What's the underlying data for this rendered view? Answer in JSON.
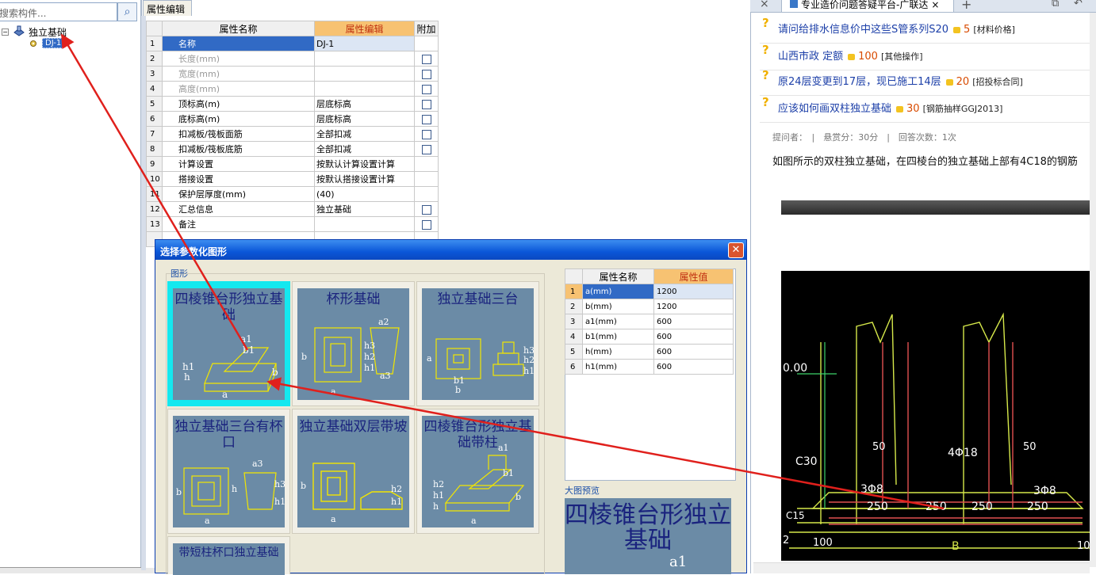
{
  "left_panel": {
    "search_placeholder": "搜索构件...",
    "tree_root": "独立基础",
    "tree_child": "DJ-1"
  },
  "mid_panel": {
    "tab_label": "属性编辑",
    "headers": [
      "属性名称",
      "属性编辑",
      "附加"
    ],
    "rows": [
      {
        "n": "1",
        "name": "名称",
        "value": "DJ-1",
        "check": false
      },
      {
        "n": "2",
        "name": "长度(mm)",
        "value": "",
        "check": true
      },
      {
        "n": "3",
        "name": "宽度(mm)",
        "value": "",
        "check": true
      },
      {
        "n": "4",
        "name": "高度(mm)",
        "value": "",
        "check": true
      },
      {
        "n": "5",
        "name": "顶标高(m)",
        "value": "层底标高",
        "check": true
      },
      {
        "n": "6",
        "name": "底标高(m)",
        "value": "层底标高",
        "check": true
      },
      {
        "n": "7",
        "name": "扣减板/筏板面筋",
        "value": "全部扣减",
        "check": true
      },
      {
        "n": "8",
        "name": "扣减板/筏板底筋",
        "value": "全部扣减",
        "check": true
      },
      {
        "n": "9",
        "name": "计算设置",
        "value": "按默认计算设置计算",
        "check": false
      },
      {
        "n": "10",
        "name": "搭接设置",
        "value": "按默认搭接设置计算",
        "check": false
      },
      {
        "n": "11",
        "name": "保护层厚度(mm)",
        "value": "(40)",
        "check": false
      },
      {
        "n": "12",
        "name": "汇总信息",
        "value": "独立基础",
        "check": true
      },
      {
        "n": "13",
        "name": "备注",
        "value": "",
        "check": true
      }
    ]
  },
  "dialog": {
    "title": "选择参数化图形",
    "group_label": "图形",
    "shapes": [
      {
        "caption": "四棱锥台形独立基础"
      },
      {
        "caption": "杯形基础"
      },
      {
        "caption": "独立基础三台"
      },
      {
        "caption": "独立基础三台有杯口"
      },
      {
        "caption": "独立基础双层带坡"
      },
      {
        "caption": "四棱锥台形独立基础带柱"
      },
      {
        "caption": "带短柱杯口独立基础"
      }
    ],
    "param_headers": [
      "属性名称",
      "属性值"
    ],
    "params": [
      {
        "n": "1",
        "name": "a(mm)",
        "value": "1200"
      },
      {
        "n": "2",
        "name": "b(mm)",
        "value": "1200"
      },
      {
        "n": "3",
        "name": "a1(mm)",
        "value": "600"
      },
      {
        "n": "4",
        "name": "b1(mm)",
        "value": "600"
      },
      {
        "n": "5",
        "name": "h(mm)",
        "value": "600"
      },
      {
        "n": "6",
        "name": "h1(mm)",
        "value": "600"
      }
    ],
    "preview_label": "大图预览",
    "preview_caption": "四棱锥台形独立基础",
    "preview_dim": "a1"
  },
  "right_panel": {
    "tab_title": "专业造价问题答疑平台-广联达",
    "questions": [
      {
        "title": "请问给排水信息价中这些S管系列S20",
        "reward": "5",
        "tag": "[材料价格]"
      },
      {
        "title": "山西市政 定额",
        "reward": "100",
        "tag": "[其他操作]"
      },
      {
        "title": "原24层变更到17层，现已施工14层",
        "reward": "20",
        "tag": "[招投标合同]"
      },
      {
        "title": "应该如何画双柱独立基础",
        "reward": "30",
        "tag": "[钢筋抽样GGJ2013]"
      }
    ],
    "meta": "提问者：　|　悬赏分：30分　|　回答次数：1次",
    "body": "如图所示的双柱独立基础，在四棱台的独立基础上部有4C18的钢筋",
    "drawing_labels": [
      "0.00",
      "C30",
      "C15",
      "50",
      "50",
      "4Φ18",
      "3Φ8",
      "3Φ8",
      "250",
      "250",
      "250",
      "250",
      "100",
      "B",
      "10",
      "2"
    ]
  },
  "colors": {
    "arrow": "#e0201c",
    "selection": "#316ac5",
    "header_highlight": "#f7c272",
    "dialog_title": "#0a56d8",
    "thumb_selected": "#14e8ef",
    "thumb_bg": "#6b8ba6"
  }
}
